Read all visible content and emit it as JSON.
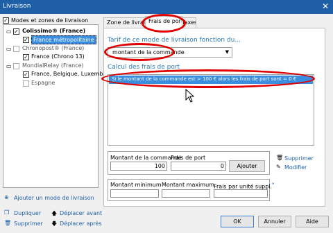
{
  "window": {
    "title": "Livraison",
    "close_glyph": "✕"
  },
  "tree": {
    "header": "Modes et zones de livraison",
    "items": [
      {
        "label": "Colissimo® (France)"
      },
      {
        "label": "France métropolitaine"
      },
      {
        "label": "Chronopost® (France)"
      },
      {
        "label": "France (Chrono 13)"
      },
      {
        "label": "MondialRelay (France)"
      },
      {
        "label": "France, Belgique, Luxembourg"
      },
      {
        "label": "Espagne"
      }
    ]
  },
  "tabs": [
    {
      "label": "Zone de livraison"
    },
    {
      "label": "Frais de port"
    },
    {
      "label": "Taxes"
    }
  ],
  "tarif": {
    "label": "Tarif de ce mode de livraison fonction du...",
    "selected": "montant de la commande"
  },
  "calcul": {
    "label": "Calcul des frais de port",
    "rows": [
      {
        "text": "Si le montant de la commande est > 100 € alors les frais de port sont = 0 €"
      }
    ]
  },
  "entry": {
    "montant_label": "Montant de la commande",
    "frais_label": "Frais de port",
    "montant_value": "100",
    "frais_value": "0",
    "add_button": "Ajouter",
    "delete": "Supprimer",
    "modify": "Modifier"
  },
  "extra": {
    "min_label": "Montant minimum",
    "max_label": "Montant maximum",
    "unit_label": "Frais par unité suppl.",
    "unit_mark": "*"
  },
  "left_actions": {
    "add_mode": "Ajouter un mode de livraison",
    "duplicate": "Dupliquer",
    "delete": "Supprimer",
    "move_up": "Déplacer avant",
    "move_down": "Déplacer après"
  },
  "footer": {
    "ok": "OK",
    "cancel": "Annuler",
    "help": "Aide"
  },
  "colors": {
    "annotation": "#e00000",
    "accent": "#2a7ab9",
    "selection": "#3a8ee0"
  }
}
